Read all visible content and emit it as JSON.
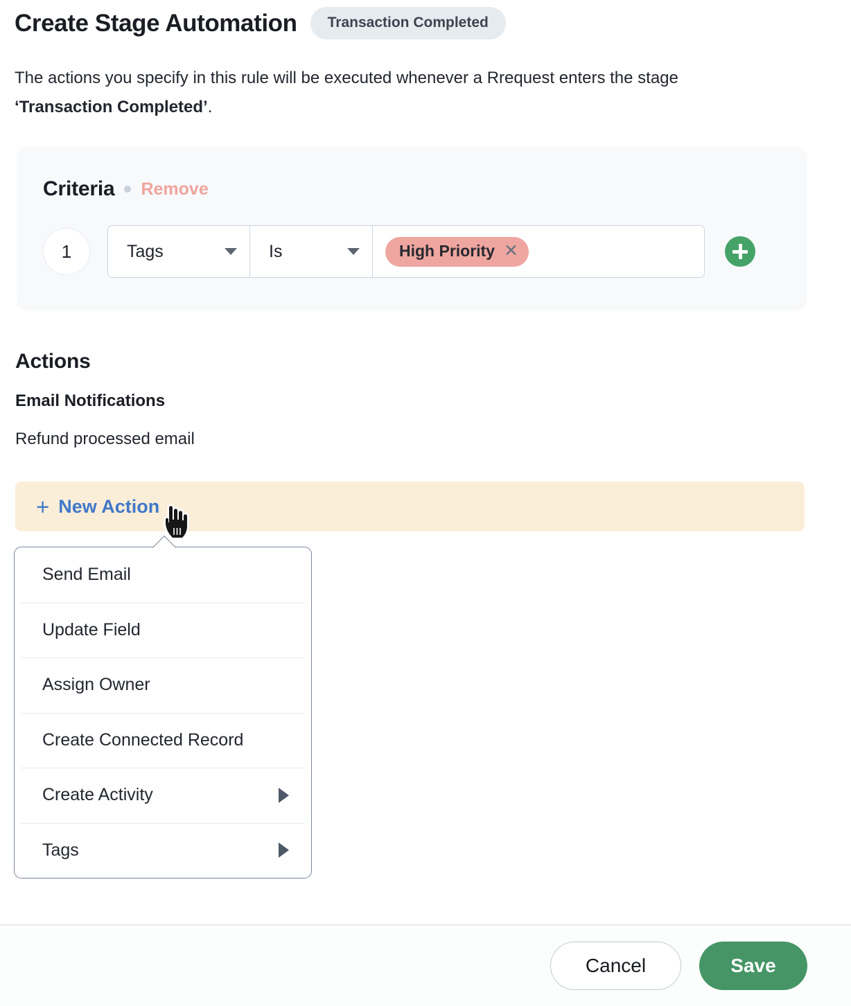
{
  "header": {
    "title": "Create Stage Automation",
    "stage_badge": "Transaction Completed"
  },
  "description": {
    "part1": "The actions you specify in this rule will be executed whenever a Rrequest enters the stage ",
    "stage_name": "‘Transaction Completed’",
    "part2": "."
  },
  "criteria": {
    "title": "Criteria",
    "remove_label": "Remove",
    "add_button_name": "add-criteria-icon",
    "rows": [
      {
        "index": "1",
        "field": "Tags",
        "operator": "Is",
        "value_chip": "High Priority",
        "chip_remove": "✕"
      }
    ]
  },
  "actions": {
    "title": "Actions",
    "subtitle": "Email Notifications",
    "item": "Refund processed email",
    "new_action_label": "New Action",
    "new_action_plus": "+"
  },
  "action_menu": {
    "items": [
      {
        "label": "Send Email",
        "has_submenu": false
      },
      {
        "label": "Update Field",
        "has_submenu": false
      },
      {
        "label": "Assign Owner",
        "has_submenu": false
      },
      {
        "label": "Create Connected Record",
        "has_submenu": false
      },
      {
        "label": "Create Activity",
        "has_submenu": true
      },
      {
        "label": "Tags",
        "has_submenu": true
      }
    ]
  },
  "footer": {
    "cancel_label": "Cancel",
    "save_label": "Save"
  },
  "colors": {
    "accent_blue": "#4178c8",
    "save_green": "#469566",
    "add_green": "#46a368",
    "chip_pink": "#efa6a0",
    "remove_pink": "#f0a49c",
    "new_action_bg": "#fbeed9",
    "badge_bg": "#e6ebef",
    "panel_bg": "#f7f9fb"
  }
}
